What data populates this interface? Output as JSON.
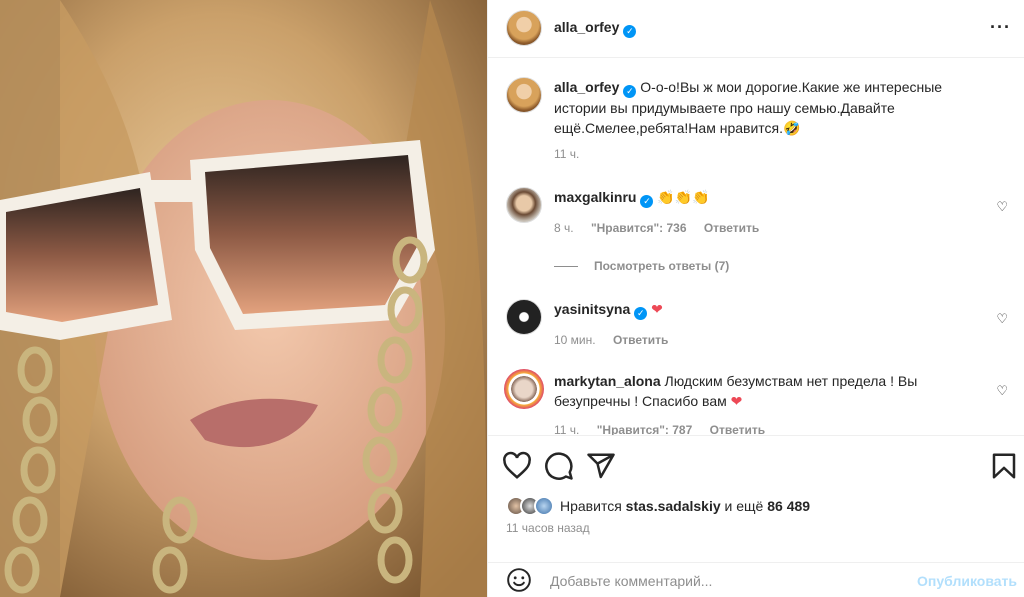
{
  "post": {
    "author": "alla_orfey",
    "more_icon": "more-horizontal-icon"
  },
  "caption": {
    "username": "alla_orfey",
    "text": "О-о-о!Вы ж мои дорогие.Какие же интересные истории вы придумываете про нашу семью.Давайте ещё.Смелее,ребята!Нам нравится.",
    "emoji": "🤣",
    "time": "11 ч."
  },
  "comments": [
    {
      "username": "maxgalkinru",
      "text": "",
      "emoji": "👏👏👏",
      "time": "8 ч.",
      "likes": "\"Нравится\": 736",
      "reply": "Ответить"
    },
    {
      "username": "yasinitsyna",
      "text": "",
      "emoji": "❤",
      "time": "10 мин.",
      "reply": "Ответить"
    },
    {
      "username": "markytan_alona",
      "text": "Людским безумствам нет предела ! Вы безупречны ! Спасибо вам",
      "emoji": "❤",
      "time": "11 ч.",
      "likes": "\"Нравится\": 787",
      "reply": "Ответить"
    }
  ],
  "view_replies": "Посмотреть ответы (7)",
  "likes_line": {
    "prefix": "Нравится",
    "user": "stas.sadalskiy",
    "middle": "и ещё",
    "count": "86 489"
  },
  "post_time": "11 часов назад",
  "composer": {
    "placeholder": "Добавьте комментарий...",
    "publish": "Опубликовать"
  },
  "colors": {
    "accent": "#0095f6",
    "publish_disabled": "#b2dffc",
    "heart_red": "#ed4956"
  }
}
